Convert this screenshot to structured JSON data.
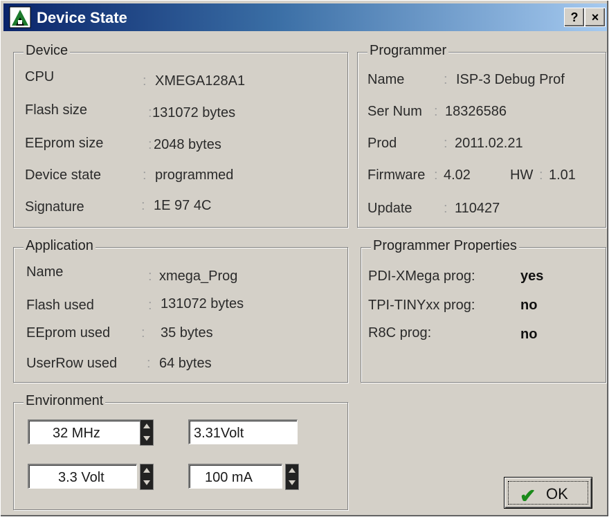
{
  "window": {
    "title": "Device State",
    "help_label": "?",
    "close_label": "×"
  },
  "device": {
    "legend": "Device",
    "rows": [
      {
        "label": "CPU",
        "value": "XMEGA128A1"
      },
      {
        "label": "Flash size",
        "value": "131072 bytes"
      },
      {
        "label": "EEprom size",
        "value": "2048 bytes"
      },
      {
        "label": "Device state",
        "value": "programmed"
      },
      {
        "label": "Signature",
        "value": "1E 97 4C"
      }
    ]
  },
  "programmer": {
    "legend": "Programmer",
    "name_label": "Name",
    "name_value": "ISP-3 Debug Prof",
    "sernum_label": "Ser Num",
    "sernum_value": "18326586",
    "prod_label": "Prod",
    "prod_value": "2011.02.21",
    "firmware_label": "Firmware",
    "firmware_value": "4.02",
    "hw_label": "HW",
    "hw_value": "1.01",
    "update_label": "Update",
    "update_value": "110427"
  },
  "application": {
    "legend": "Application",
    "rows": [
      {
        "label": "Name",
        "value": "xmega_Prog"
      },
      {
        "label": "Flash used",
        "value": "131072 bytes"
      },
      {
        "label": "EEprom used",
        "value": "35 bytes"
      },
      {
        "label": "UserRow used",
        "value": "64 bytes"
      }
    ]
  },
  "properties": {
    "legend": "Programmer Properties",
    "rows": [
      {
        "label": "PDI-XMega prog:",
        "value": "yes"
      },
      {
        "label": "TPI-TINYxx prog:",
        "value": "no"
      },
      {
        "label": "R8C prog:",
        "value": "no"
      }
    ]
  },
  "environment": {
    "legend": "Environment",
    "frequency": "32 MHz",
    "voltage_measured": "3.31Volt",
    "voltage_set": "3.3  Volt",
    "current": "100 mA"
  },
  "buttons": {
    "ok_label": "OK"
  },
  "icons": {
    "ok": "checkmark-icon",
    "spin": "spin-updown-icon",
    "app": "app-logo-icon"
  },
  "colors": {
    "titlebar_start": "#0a246a",
    "titlebar_end": "#a6caf0",
    "face": "#d4d0c8",
    "check": "#1a8a1a"
  }
}
